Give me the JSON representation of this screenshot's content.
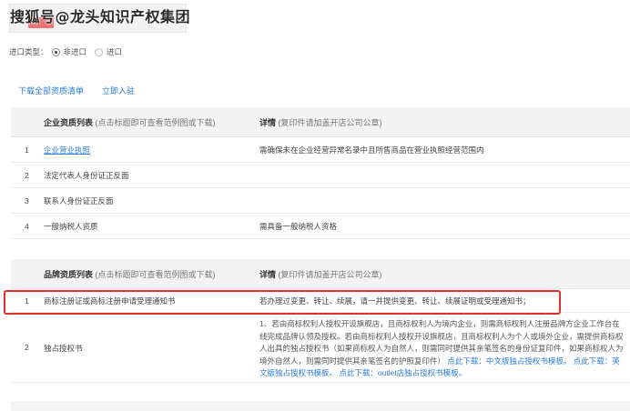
{
  "watermark": "搜狐号@龙头知识产权集团",
  "import_type": {
    "label": "进口类型：",
    "options": [
      {
        "label": "非进口",
        "checked": true
      },
      {
        "label": "进口",
        "checked": false
      }
    ]
  },
  "actions": {
    "download_all": "下载全部资质清单",
    "import_now": "立即入驻"
  },
  "enterprise": {
    "title": "企业资质列表",
    "hint": "(点击标题即可查看范例图或下载)",
    "detail_title": "详情",
    "detail_hint": "(复印件请加盖开店公司公章)",
    "rows": [
      {
        "num": "1",
        "name": "企业营业执照",
        "desc": "需确保未在企业经营异常名录中且所售商品在营业执照经营范围内"
      },
      {
        "num": "2",
        "name": "法定代表人身份证正反面",
        "desc": ""
      },
      {
        "num": "3",
        "name": "联系人身份证正反面",
        "desc": ""
      },
      {
        "num": "4",
        "name": "一般纳税人资质",
        "desc": "需具备一般纳税人资格"
      }
    ]
  },
  "brand": {
    "title": "品牌资质列表",
    "hint": "(点击标题即可查看范例图或下载)",
    "detail_title": "详情",
    "detail_hint": "(复印件请加盖开店公司公章)",
    "row1": {
      "num": "1",
      "name": "商标注册证或商标注册申请受理通知书",
      "desc": "若办理过变更、转让、续展，请一并提供变更、转让、续展证明或受理通知书；"
    },
    "row2": {
      "num": "2",
      "name": "独占授权书",
      "desc": "1、若由商标权利人授权开设旗舰店，且商标权利人为境内企业，则需商标权利人注册品牌方企业工作台在线完成品牌认领及授权。若由商标权利人授权开设旗舰店，且商标权利人为个人或境外企业，需提供商标权人出具的独占授权书（如果商标权人为自然人，则需同时提供其亲笔签名的身份证复印件，如果商标权人为境外自然人，则需同时提供其亲笔签名的护照复印件）",
      "link1": "点此下载：中文版独占授权书模板。",
      "link2": "点此下载：英文版独占授权书模板。",
      "link3": "点此下载：outlet店独占授权书模板。"
    }
  }
}
